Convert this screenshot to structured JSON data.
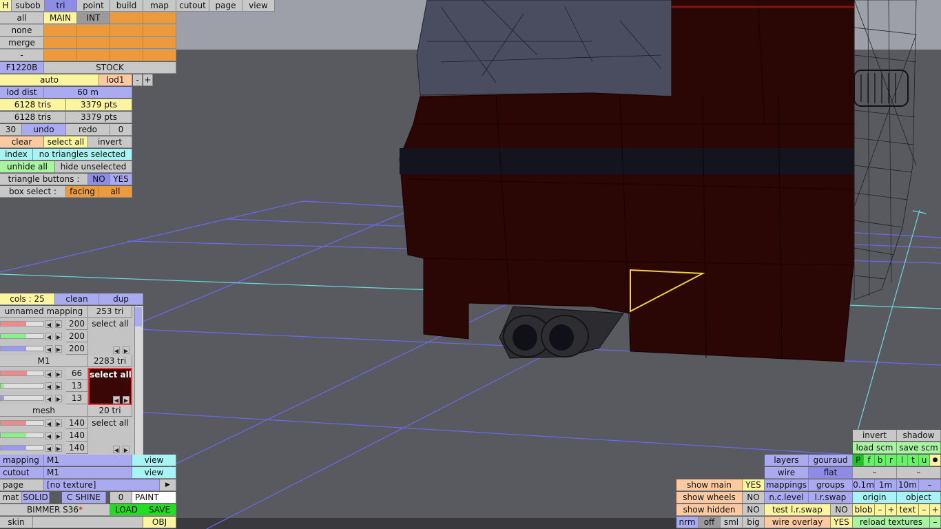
{
  "menu_bar": {
    "h": "H",
    "subob": "subob",
    "tri": "tri",
    "point": "point",
    "build": "build",
    "map": "map",
    "cutout": "cutout",
    "page": "page",
    "view": "view"
  },
  "select_panel": {
    "all": "all",
    "main": "MAIN",
    "int": "INT",
    "none": "none",
    "merge": "merge",
    "minus": "-",
    "model_code": "F1220B",
    "stock": "STOCK",
    "auto": "auto",
    "lod": "lod1",
    "lod_minus": "-",
    "lod_plus": "+",
    "lod_dist_label": "lod dist",
    "lod_dist_value": "60 m",
    "tris_1": "6128 tris",
    "pts_1": "3379 pts",
    "tris_2": "6128 tris",
    "pts_2": "3379 pts",
    "undo_count": "30",
    "undo": "undo",
    "redo": "redo",
    "redo_count": "0",
    "clear": "clear",
    "select_all": "select all",
    "invert": "invert",
    "index": "index",
    "selection_status": "no triangles selected",
    "unhide_all": "unhide all",
    "hide_unselected": "hide unselected",
    "triangle_buttons_label": "triangle buttons :",
    "no": "NO",
    "yes": "YES",
    "box_select_label": "box select :",
    "facing": "facing",
    "box_all": "all"
  },
  "colour_panel": {
    "cols": "cols : 25",
    "clean": "clean",
    "dup": "dup",
    "groups": [
      {
        "name": "unnamed mapping",
        "tris": "253 tri",
        "v1": "200",
        "v2": "200",
        "v3": "200",
        "select": "select all",
        "r": 0.6,
        "g": 0.6,
        "b": 0.6
      },
      {
        "name": "M1",
        "tris": "2283 tri",
        "v1": "66",
        "v2": "13",
        "v3": "13",
        "select": "select all",
        "r": 0.62,
        "g": 0.08,
        "b": 0.08
      },
      {
        "name": "mesh",
        "tris": "20 tri",
        "v1": "140",
        "v2": "140",
        "v3": "140",
        "select": "select all",
        "r": 0.6,
        "g": 0.6,
        "b": 0.6
      }
    ]
  },
  "bottom_left": {
    "mapping_label": "mapping",
    "mapping_value": "M1",
    "view1": "view",
    "cutout_label": "cutout",
    "cutout_value": "M1",
    "view2": "view",
    "page_label": "page",
    "page_value": "[no texture]",
    "page_arrow": "▶",
    "mat": "mat",
    "solid": "SOLID",
    "cshine": "C SHINE",
    "mat_num": "0",
    "paint": "PAINT",
    "car_name": "BIMMER S36",
    "modified_mark": "*",
    "load": "LOAD",
    "save": "SAVE",
    "skin": "skin",
    "obj": "OBJ"
  },
  "bottom_right": {
    "invert": "invert",
    "shadow": "shadow",
    "load_scm": "load scm",
    "save_scm": "save scm",
    "layers": "layers",
    "gouraud": "gouraud",
    "pfbrltu": [
      "P",
      "f",
      "b",
      "r",
      "l",
      "t",
      "u"
    ],
    "dot": "●",
    "wire": "wire",
    "flat": "flat",
    "dash1": "–",
    "dash2": "–",
    "show_main": "show main",
    "show_main_val": "YES",
    "mappings": "mappings",
    "groups": "groups",
    "d01": "0.1m",
    "d1": "1m",
    "d10": "10m",
    "dminus": "–",
    "show_wheels": "show wheels",
    "show_wheels_val": "NO",
    "nclevel": "n.c.level",
    "lrswap": "l.r.swap",
    "origin": "origin",
    "object": "object",
    "show_hidden": "show hidden",
    "show_hidden_val": "NO",
    "test_lrswap": "test l.r.swap",
    "test_val": "NO",
    "blob": "blob",
    "blob_m": "–",
    "blob_p": "+",
    "text": "text",
    "text_m": "–",
    "text_p": "+",
    "nrm": "nrm",
    "off": "off",
    "sml": "sml",
    "big": "big",
    "wire_overlay": "wire overlay",
    "wire_overlay_val": "YES",
    "reload": "reload textures",
    "reload_m": "–"
  },
  "colors": {
    "accent": "#aaaaf0",
    "selected": "#8d8de8",
    "orange": "#ec9a3c",
    "yellow": "#fbf5a0",
    "green": "#6cf06c",
    "car_body": "#2a0604"
  }
}
